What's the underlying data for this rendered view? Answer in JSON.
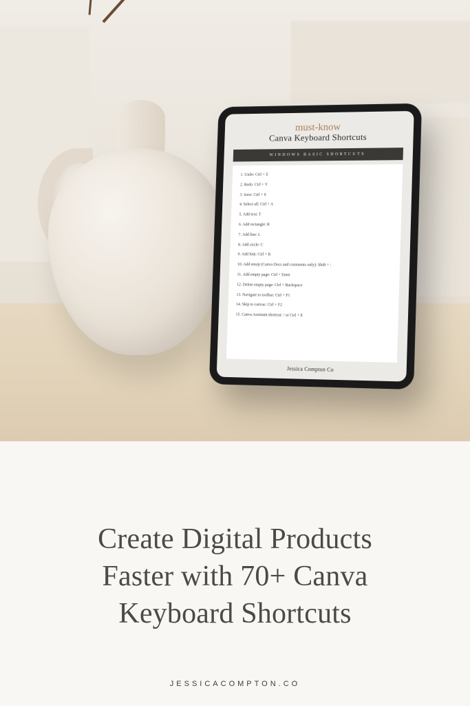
{
  "tablet": {
    "script_label": "must-know",
    "title": "Canva Keyboard Shortcuts",
    "section_bar": "WINDOWS BASIC SHORTCUTS",
    "shortcuts": [
      "1. Undo: Ctrl + Z",
      "2. Redo: Ctrl + Y",
      "3. Save: Ctrl + S",
      "4. Select all: Ctrl + A",
      "5. Add text: T",
      "6. Add rectangle: R",
      "7. Add line: L",
      "8. Add circle: C",
      "9. Add link: Ctrl + K",
      "10. Add emoji (Canva Docs and comments only): Shift + :",
      "11. Add empty page: Ctrl + Enter",
      "12. Delete empty page: Ctrl + Backspace",
      "13. Navigate to toolbar: Ctrl + F1",
      "14. Skip to canvas: Ctrl + F2",
      "15. Canva Assistant shortcut: / or Ctrl + E"
    ],
    "footer": "Jessica Compton Co"
  },
  "headline_lines": [
    "Create Digital Products",
    "Faster with 70+ Canva",
    "Keyboard Shortcuts"
  ],
  "site_label": "JESSICACOMPTON.CO"
}
